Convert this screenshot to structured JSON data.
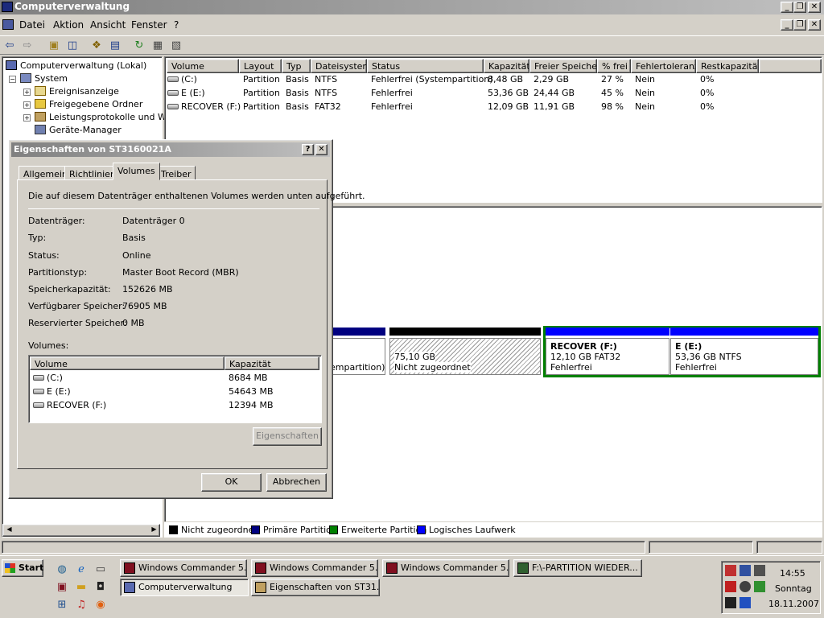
{
  "window": {
    "title": "Computerverwaltung"
  },
  "menu": [
    "Datei",
    "Aktion",
    "Ansicht",
    "Fenster",
    "?"
  ],
  "tree": {
    "root": "Computerverwaltung (Lokal)",
    "system": "System",
    "items": [
      "Ereignisanzeige",
      "Freigegebene Ordner",
      "Leistungsprotokolle und War",
      "Geräte-Manager"
    ]
  },
  "volumes": {
    "columns": [
      "Volume",
      "Layout",
      "Typ",
      "Dateisystem",
      "Status",
      "Kapazität",
      "Freier Speicher",
      "% frei",
      "Fehlertoleranz",
      "Restkapazität"
    ],
    "rows": [
      [
        "(C:)",
        "Partition",
        "Basis",
        "NTFS",
        "Fehlerfrei (Systempartition)",
        "8,48 GB",
        "2,29 GB",
        "27 %",
        "Nein",
        "0%"
      ],
      [
        "E (E:)",
        "Partition",
        "Basis",
        "NTFS",
        "Fehlerfrei",
        "53,36 GB",
        "24,44 GB",
        "45 %",
        "Nein",
        "0%"
      ],
      [
        "RECOVER (F:)",
        "Partition",
        "Basis",
        "FAT32",
        "Fehlerfrei",
        "12,09 GB",
        "11,91 GB",
        "98 %",
        "Nein",
        "0%"
      ]
    ]
  },
  "graph": {
    "c_partial": "empartition)",
    "unalloc": {
      "size": "75,10 GB",
      "label": "Nicht zugeordnet"
    },
    "recover": {
      "name": "RECOVER  (F:)",
      "size": "12,10 GB FAT32",
      "status": "Fehlerfrei"
    },
    "e": {
      "name": "E  (E:)",
      "size": "53,36 GB NTFS",
      "status": "Fehlerfrei"
    },
    "colors": {
      "primary": "#000080",
      "unalloc": "#000000",
      "extended": "#008000",
      "logical": "#0000ff"
    }
  },
  "legend": [
    "Nicht zugeordnet",
    "Primäre Partition",
    "Erweiterte Partition",
    "Logisches Laufwerk"
  ],
  "dialog": {
    "title": "Eigenschaften von ST3160021A",
    "tabs": [
      "Allgemein",
      "Richtlinien",
      "Volumes",
      "Treiber"
    ],
    "intro": "Die auf diesem Datenträger enthaltenen Volumes werden unten aufgeführt.",
    "props": [
      [
        "Datenträger:",
        "Datenträger 0"
      ],
      [
        "Typ:",
        "Basis"
      ],
      [
        "Status:",
        "Online"
      ],
      [
        "Partitionstyp:",
        "Master Boot Record (MBR)"
      ],
      [
        "Speicherkapazität:",
        "152626 MB"
      ],
      [
        "Verfügbarer Speicher:",
        "76905 MB"
      ],
      [
        "Reservierter Speicher:",
        "0 MB"
      ]
    ],
    "volumes_label": "Volumes:",
    "vol_columns": [
      "Volume",
      "Kapazität"
    ],
    "vol_rows": [
      [
        "(C:)",
        "8684 MB"
      ],
      [
        "E (E:)",
        "54643 MB"
      ],
      [
        "RECOVER (F:)",
        "12394 MB"
      ]
    ],
    "props_button": "Eigenschaften",
    "ok": "OK",
    "cancel": "Abbrechen"
  },
  "taskbar": {
    "start": "Start",
    "buttons": [
      "Windows Commander 5....",
      "Windows Commander 5....",
      "Windows Commander 5....",
      "F:\\-PARTITION WIEDER...",
      "Computerverwaltung",
      "Eigenschaften von ST31..."
    ],
    "time": "14:55",
    "day": "Sonntag",
    "date": "18.11.2007"
  }
}
